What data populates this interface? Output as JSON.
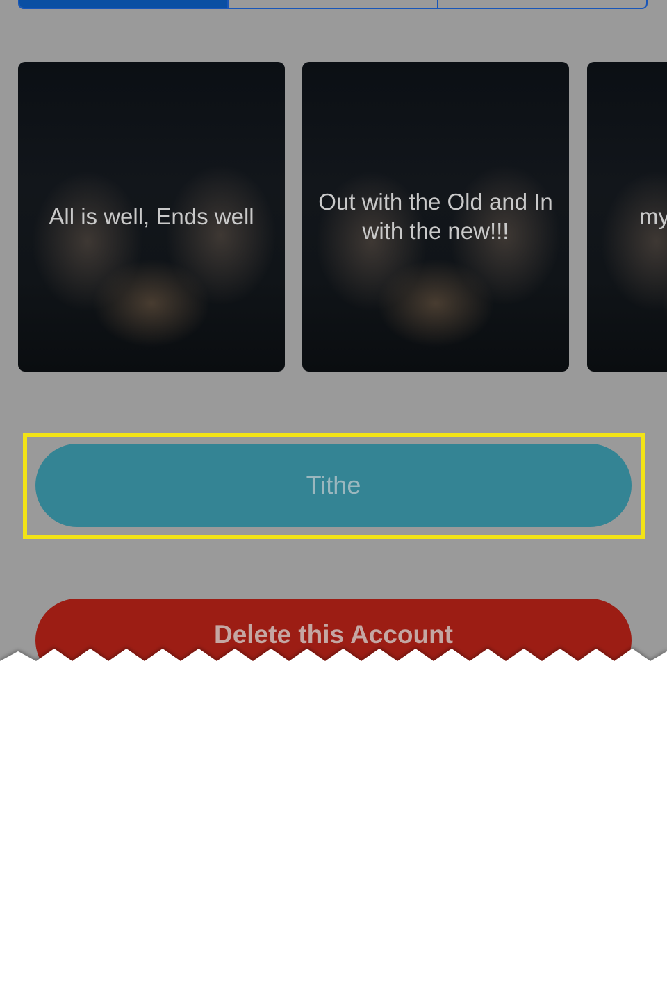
{
  "segmented_control": {
    "segments": [
      "",
      "",
      ""
    ],
    "active_index": 0
  },
  "cards": [
    {
      "text": "All is well, Ends well"
    },
    {
      "text": "Out with the Old and In with the new!!!"
    },
    {
      "text": "my"
    }
  ],
  "tithe_button": {
    "label": "Tithe"
  },
  "delete_button": {
    "label": "Delete this Account"
  },
  "colors": {
    "overlay_gray": "#9a9a9a",
    "segment_blue": "#0a4fa3",
    "tithe_teal": "#348494",
    "delete_red": "#9c1d14",
    "highlight_yellow": "#f2e417"
  }
}
